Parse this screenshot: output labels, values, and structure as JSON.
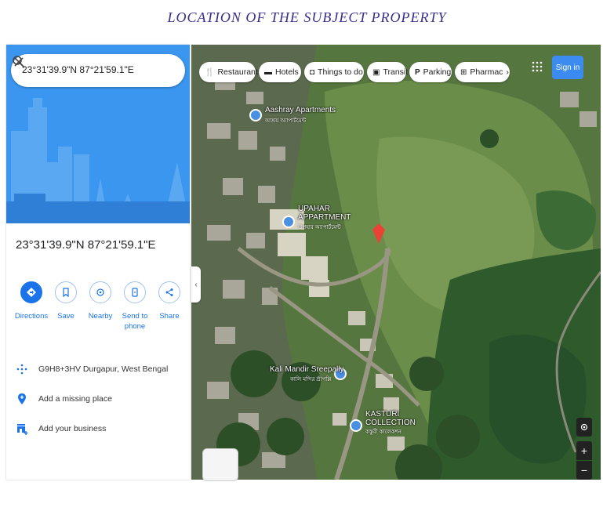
{
  "page_title": "LOCATION OF THE SUBJECT PROPERTY",
  "search": {
    "value": "23°31'39.9\"N 87°21'59.1\"E"
  },
  "place": {
    "title": "23°31'39.9\"N 87°21'59.1\"E"
  },
  "actions": [
    {
      "label": "Directions",
      "icon": "directions-icon"
    },
    {
      "label": "Save",
      "icon": "bookmark-icon"
    },
    {
      "label": "Nearby",
      "icon": "nearby-icon"
    },
    {
      "label": "Send to\nphone",
      "icon": "send-to-phone-icon"
    },
    {
      "label": "Share",
      "icon": "share-icon"
    }
  ],
  "info": [
    {
      "text": "G9H8+3HV Durgapur, West Bengal",
      "icon": "plus-code-icon"
    },
    {
      "text": "Add a missing place",
      "icon": "add-place-icon"
    },
    {
      "text": "Add your business",
      "icon": "add-business-icon"
    }
  ],
  "chips": [
    {
      "label": "Restaurants",
      "icon": "restaurant-icon"
    },
    {
      "label": "Hotels",
      "icon": "hotel-icon"
    },
    {
      "label": "Things to do",
      "icon": "camera-icon"
    },
    {
      "label": "Transit",
      "icon": "transit-icon"
    },
    {
      "label": "Parking",
      "icon": "parking-icon"
    },
    {
      "label": "Pharmac",
      "icon": "pharmacy-icon"
    }
  ],
  "sign_in": "Sign in",
  "map_labels": {
    "aashray": "Aashray Apartments",
    "aashray_local": "আশ্রয় অ্যাপার্টমেন্ট",
    "upahar_1": "UPAHAR",
    "upahar_2": "APPARTMENT",
    "upahar_local": "উপহার অ্যাপার্টমেন্ট",
    "kali": "Kali Mandir Sreepally",
    "kali_local": "কালি মন্দির শ্রীপল্লি",
    "kasturi_1": "KASTURI",
    "kasturi_2": "COLLECTION",
    "kasturi_local": "কস্তুরী কালেকশন"
  },
  "colors": {
    "accent": "#1a73e8",
    "hero": "#3b96f0",
    "marker": "#ea4335",
    "title": "#3a2e8c"
  }
}
